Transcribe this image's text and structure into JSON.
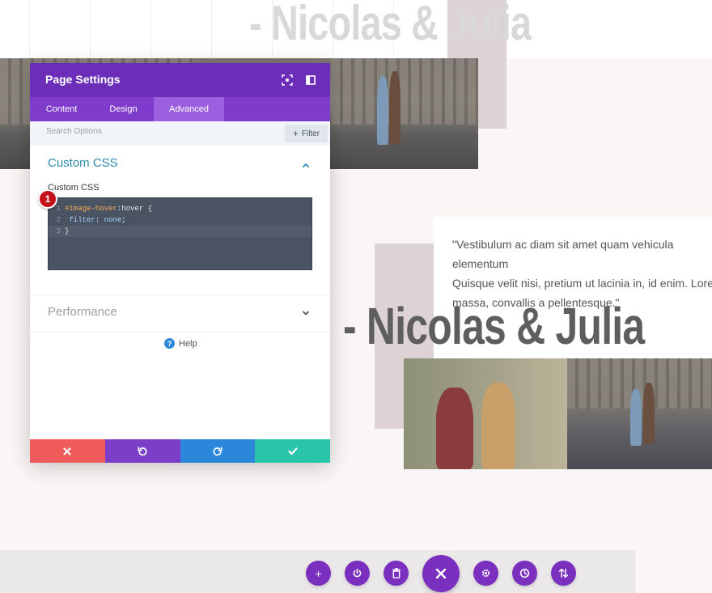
{
  "website": {
    "heading_faded": "- Nicolas & Julia",
    "heading_main": "- Nicolas & Julia",
    "quote": "\"Vestibulum ac diam sit amet quam vehicula elementum\nQuisque velit nisi, pretium ut lacinia in, id enim. Lorem\nmassa, convallis a pellentesque.\""
  },
  "modal": {
    "title": "Page Settings",
    "header_icons": [
      "screenshot-icon",
      "sidebar-toggle-icon"
    ],
    "tabs": [
      {
        "label": "Content",
        "active": false
      },
      {
        "label": "Design",
        "active": false
      },
      {
        "label": "Advanced",
        "active": true
      }
    ],
    "search": {
      "placeholder": "Search Options",
      "value": ""
    },
    "filter_label": "Filter",
    "sections": {
      "custom_css": {
        "title": "Custom CSS",
        "expanded": true,
        "field_label": "Custom CSS",
        "code": {
          "line1": {
            "num": "1",
            "selector": "#image-hover",
            "pseudo": ":hover",
            "rest": " {"
          },
          "line2": {
            "num": "2",
            "property": "filter",
            "colon": ": ",
            "value": "none",
            "end": ";"
          },
          "line3": {
            "num": "3",
            "text": "}"
          }
        }
      },
      "performance": {
        "title": "Performance",
        "expanded": false
      }
    },
    "step_badge": "1",
    "help_label": "Help",
    "footer": {
      "cancel_color": "#ef5a5a",
      "undo_color": "#7b3fc7",
      "redo_color": "#2b87da",
      "save_color": "#29c4a9"
    }
  },
  "toolbar": {
    "buttons": [
      "add-icon",
      "power-icon",
      "trash-icon",
      "close-icon",
      "gear-icon",
      "history-icon",
      "sort-icon"
    ],
    "accent": "#7b2fbf"
  },
  "colors": {
    "header_purple": "#6c2eb9",
    "tab_purple": "#7f3ccc",
    "link_blue": "#2e8bb0",
    "badge_red": "#c4121b"
  }
}
